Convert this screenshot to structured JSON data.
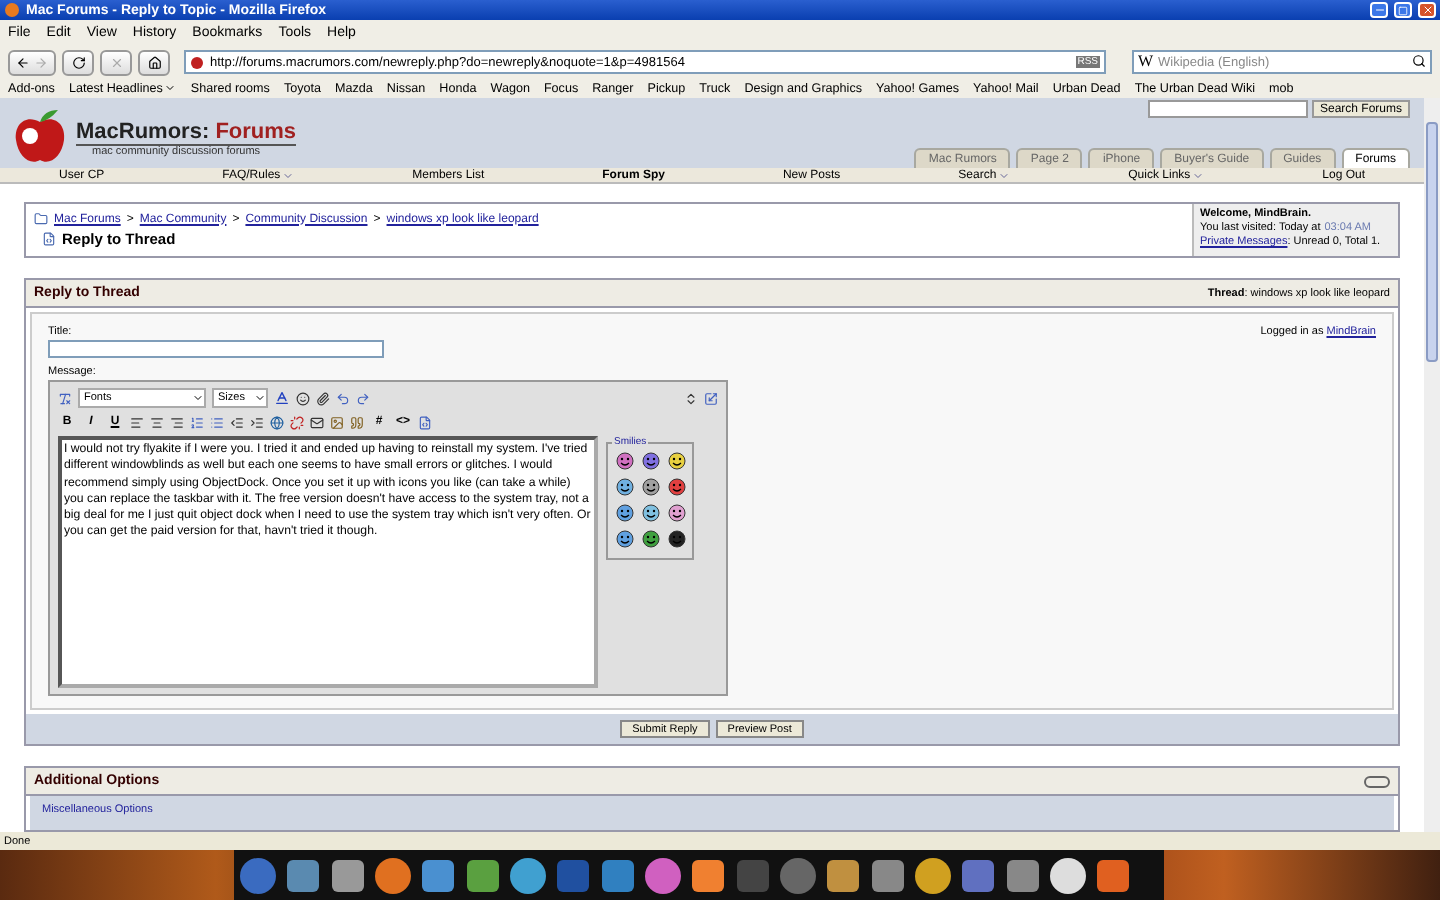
{
  "window": {
    "title": "Mac Forums - Reply to Topic - Mozilla Firefox"
  },
  "menu": [
    "File",
    "Edit",
    "View",
    "History",
    "Bookmarks",
    "Tools",
    "Help"
  ],
  "address_bar": {
    "url": "http://forums.macrumors.com/newreply.php?do=newreply&noquote=1&p=4981564",
    "feed_badge": "RSS"
  },
  "search_bar": {
    "engine": "W",
    "placeholder": "Wikipedia (English)"
  },
  "bookmarks": [
    {
      "label": "Add-ons",
      "dropdown": false
    },
    {
      "label": "Latest Headlines",
      "dropdown": true
    },
    {
      "label": "Shared rooms",
      "dropdown": false
    },
    {
      "label": "Toyota",
      "dropdown": false
    },
    {
      "label": "Mazda",
      "dropdown": false
    },
    {
      "label": "Nissan",
      "dropdown": false
    },
    {
      "label": "Honda",
      "dropdown": false
    },
    {
      "label": "Wagon",
      "dropdown": false
    },
    {
      "label": "Focus",
      "dropdown": false
    },
    {
      "label": "Ranger",
      "dropdown": false
    },
    {
      "label": "Pickup",
      "dropdown": false
    },
    {
      "label": "Truck",
      "dropdown": false
    },
    {
      "label": "Design and Graphics",
      "dropdown": false
    },
    {
      "label": "Yahoo! Games",
      "dropdown": false
    },
    {
      "label": "Yahoo! Mail",
      "dropdown": false
    },
    {
      "label": "Urban Dead",
      "dropdown": false
    },
    {
      "label": "The Urban Dead Wiki",
      "dropdown": false
    },
    {
      "label": "mob",
      "dropdown": false
    }
  ],
  "site": {
    "logo_name": "MacRumors:",
    "logo_accent": "Forums",
    "tagline": "mac community discussion forums",
    "search_button": "Search Forums",
    "tabs": [
      {
        "label": "Mac Rumors",
        "selected": false
      },
      {
        "label": "Page 2",
        "selected": false
      },
      {
        "label": "iPhone",
        "selected": false
      },
      {
        "label": "Buyer's Guide",
        "selected": false
      },
      {
        "label": "Guides",
        "selected": false
      },
      {
        "label": "Forums",
        "selected": true
      }
    ],
    "nav": [
      {
        "label": "User CP",
        "dropdown": false,
        "selected": false
      },
      {
        "label": "FAQ/Rules",
        "dropdown": true,
        "selected": false
      },
      {
        "label": "Members List",
        "dropdown": false,
        "selected": false
      },
      {
        "label": "Forum Spy",
        "dropdown": false,
        "selected": true
      },
      {
        "label": "New Posts",
        "dropdown": false,
        "selected": false
      },
      {
        "label": "Search",
        "dropdown": true,
        "selected": false
      },
      {
        "label": "Quick Links",
        "dropdown": true,
        "selected": false
      },
      {
        "label": "Log Out",
        "dropdown": false,
        "selected": false
      }
    ]
  },
  "breadcrumb": {
    "links": [
      "Mac Forums",
      "Mac Community",
      "Community Discussion",
      "windows xp look like leopard"
    ],
    "separator": ">",
    "title": "Reply to Thread"
  },
  "welcome": {
    "heading": "Welcome, MindBrain.",
    "last_visit": "You last visited: Today at",
    "last_visit_time": "03:04 AM",
    "pm_link": "Private Messages",
    "pm_status": ": Unread 0, Total 1."
  },
  "reply": {
    "heading": "Reply to Thread",
    "thread_label": "Thread",
    "thread_title": ": windows xp look like leopard",
    "title_label": "Title:",
    "message_label": "Message:",
    "logged_in": "Logged in as",
    "user": "MindBrain",
    "font_select": "Fonts",
    "size_select": "Sizes",
    "format_buttons": [
      "B",
      "I",
      "U"
    ],
    "code_buttons": [
      "#",
      "<>"
    ],
    "message": "I would not try flyakite if I were you. I tried it and ended up having to reinstall my system. I've tried different windowblinds as well but each one seems to have small errors or glitches. I would recommend simply using ObjectDock. Once you set it up with icons you like (can take a while) you can replace the taskbar with it. The free version doesn't have access to the system tray, not a big deal for me I just quit object dock when I need to use the system tray which isn't very often. Or you can get the paid version for that, havn't tried it though.",
    "smilies_label": "Smilies",
    "buttons": [
      "Submit Reply",
      "Preview Post"
    ]
  },
  "additional": {
    "heading": "Additional Options",
    "legend": "Miscellaneous Options"
  },
  "status_bar": {
    "text": "Done"
  }
}
